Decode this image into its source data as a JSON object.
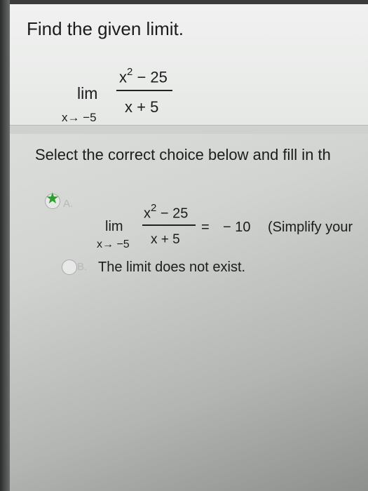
{
  "question": {
    "title": "Find the given limit.",
    "lim_word": "lim",
    "lim_sub": "x→ −5",
    "numerator_base": "x",
    "numerator_exp": "2",
    "numerator_rest": " − 25",
    "denominator": "x + 5"
  },
  "prompt": "Select the correct choice below and fill in th",
  "choices": [
    {
      "letter": "A.",
      "selected": true,
      "lim_word": "lim",
      "lim_sub": "x→ −5",
      "numerator_base": "x",
      "numerator_exp": "2",
      "numerator_rest": " − 25",
      "denominator": "x + 5",
      "equals": "=",
      "answer_value": "− 10",
      "hint": "(Simplify your"
    },
    {
      "letter": "B.",
      "selected": false,
      "text": "The limit does not exist."
    }
  ],
  "colors": {
    "star": "#2ca02c",
    "text": "#1c1c1c"
  },
  "icons": {
    "selected_marker": "star-icon"
  }
}
